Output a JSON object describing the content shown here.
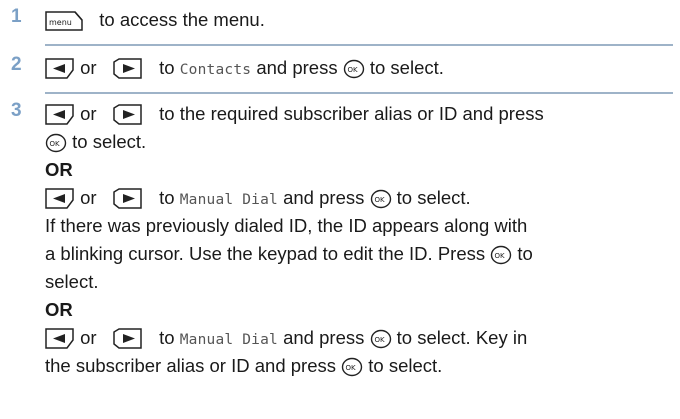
{
  "steps": [
    {
      "number": "1",
      "keys": {
        "menu": "menu"
      },
      "text_after_menu": "to access the menu."
    },
    {
      "number": "2",
      "or_word": "or",
      "to_word": "to",
      "menu_item": "Contacts",
      "text_press": "and press",
      "text_select": "to select."
    },
    {
      "number": "3",
      "or_word": "or",
      "line1_text": "to the required subscriber alias or ID and press",
      "line2_text": "to select.",
      "or_label_1": "OR",
      "to_word": "to",
      "menu_item_1": "Manual Dial",
      "line4_press": "and press",
      "line4_select": "to select.",
      "line5_text": "If there was previously dialed ID, the ID appears along with",
      "line6_text": "a blinking cursor. Use the keypad to edit the ID. Press",
      "line6_to": "to",
      "line7_text": "select.",
      "or_label_2": "OR",
      "menu_item_2": "Manual Dial",
      "line9_press": "and press",
      "line9_select": "to select. Key in",
      "line10_text": "the subscriber alias or ID and press",
      "line10_select": "to select."
    }
  ],
  "icons": {
    "menu_key": "menu-key-icon",
    "left_arrow": "left-arrow-key-icon",
    "right_arrow": "right-arrow-key-icon",
    "ok_key": "ok-key-icon"
  },
  "colors": {
    "step_number": "#7ba0c6",
    "separator": "#9eb3c8",
    "text": "#1a1a1a"
  }
}
